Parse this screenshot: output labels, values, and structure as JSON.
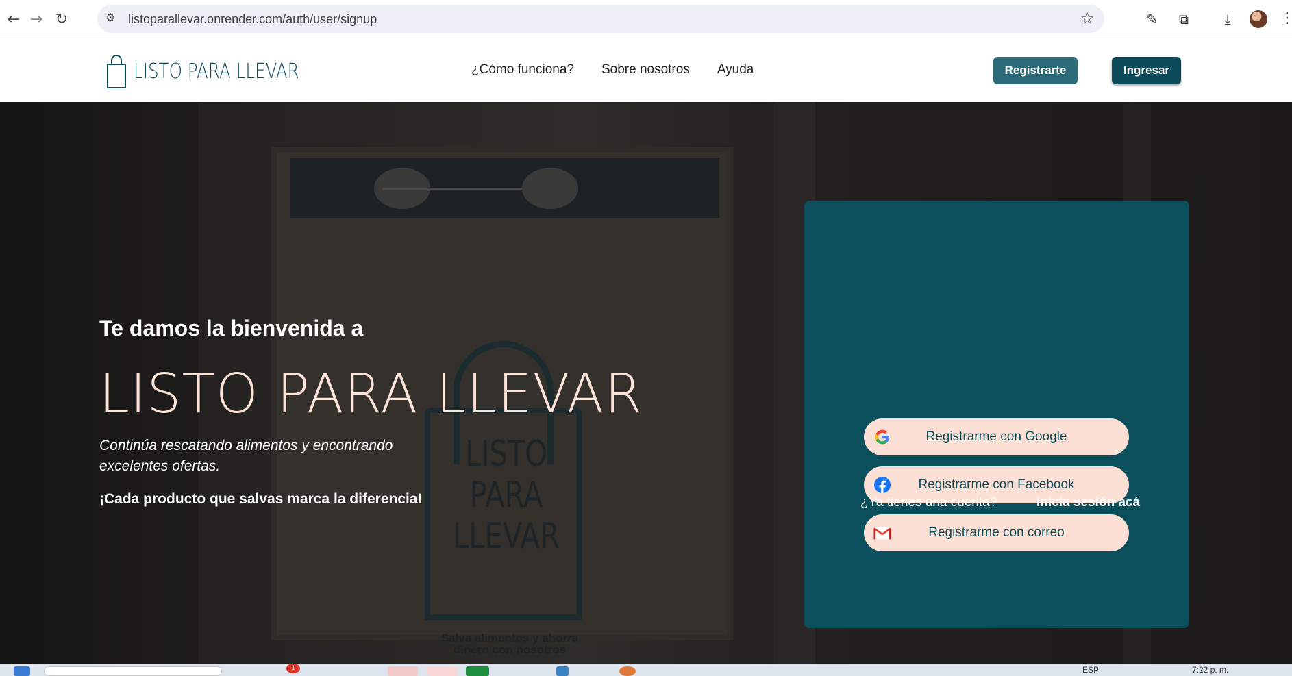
{
  "browser": {
    "url": "listoparallevar.onrender.com/auth/user/signup",
    "icons": [
      "back-icon",
      "forward-icon",
      "reload-icon",
      "site-info-icon",
      "bookmark-star-icon",
      "eyedropper-icon",
      "extensions-icon",
      "download-icon",
      "profile-avatar",
      "more-menu-icon"
    ]
  },
  "header": {
    "logo_text": "LISTO PARA LLEVAR",
    "nav": [
      {
        "label": "¿Cómo funciona?"
      },
      {
        "label": "Sobre nosotros"
      },
      {
        "label": "Ayuda"
      }
    ],
    "register_label": "Registrarte",
    "login_label": "Ingresar"
  },
  "hero": {
    "welcome": "Te damos la bienvenida a",
    "title": "LISTO PARA LLEVAR",
    "subtitle": "Continúa rescatando alimentos y encontrando excelentes ofertas.",
    "cta": "¡Cada producto que salvas marca la diferencia!",
    "sign": {
      "words": [
        "LISTO",
        "PARA",
        "LLEVAR"
      ],
      "tagline_1": "Salva alimentos y ahorra",
      "tagline_2": "dinero con nosotros"
    }
  },
  "signup": {
    "google_label": "Registrarme con Google",
    "facebook_label": "Registrarme con Facebook",
    "email_label": "Registrarme con correo",
    "have_account": "¿Ya tienes una cuenta?",
    "login_link": "Inicia sesión acá"
  },
  "taskbar": {
    "notification_count": "1",
    "language": "ESP",
    "time": "7:22 p. m."
  },
  "colors": {
    "brand_dark": "#0b4e5c",
    "brand_mid": "#2b6b78",
    "peach": "#fde0d5"
  }
}
